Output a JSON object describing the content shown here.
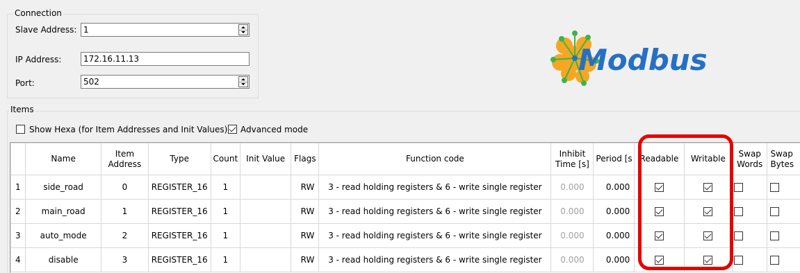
{
  "connection": {
    "group_label": "Connection",
    "slave_address_label": "Slave Address:",
    "slave_address_value": "1",
    "ip_address_label": "IP Address:",
    "ip_address_value": "172.16.11.13",
    "port_label": "Port:",
    "port_value": "502"
  },
  "logo": {
    "text": "Modbus"
  },
  "items": {
    "group_label": "Items",
    "show_hexa_label": "Show Hexa (for Item Addresses and Init Values)",
    "show_hexa_checked": false,
    "advanced_mode_label": "Advanced mode",
    "advanced_mode_checked": true
  },
  "table": {
    "headers": {
      "name": "Name",
      "item_address_l1": "Item",
      "item_address_l2": "Address",
      "type": "Type",
      "count": "Count",
      "init_value": "Init Value",
      "flags": "Flags",
      "function_code": "Function code",
      "inhibit_l1": "Inhibit",
      "inhibit_l2": "Time [s]",
      "period": "Period [s",
      "readable": "Readable",
      "writable": "Writable",
      "swap_words_l1": "Swap",
      "swap_words_l2": "Words",
      "swap_bytes_l1": "Swap",
      "swap_bytes_l2": "Bytes"
    },
    "rows": [
      {
        "num": "1",
        "name": "side_road",
        "address": "0",
        "type": "REGISTER_16",
        "count": "1",
        "init": "",
        "flags": "RW",
        "function": "3 - read holding registers & 6 - write single register",
        "inhibit": "0.000",
        "period": "0.000",
        "readable": true,
        "writable": true,
        "swap_words": false,
        "swap_bytes": false
      },
      {
        "num": "2",
        "name": "main_road",
        "address": "1",
        "type": "REGISTER_16",
        "count": "1",
        "init": "",
        "flags": "RW",
        "function": "3 - read holding registers & 6 - write single register",
        "inhibit": "0.000",
        "period": "0.000",
        "readable": true,
        "writable": true,
        "swap_words": false,
        "swap_bytes": false
      },
      {
        "num": "3",
        "name": "auto_mode",
        "address": "2",
        "type": "REGISTER_16",
        "count": "1",
        "init": "",
        "flags": "RW",
        "function": "3 - read holding registers & 6 - write single register",
        "inhibit": "0.000",
        "period": "0.000",
        "readable": true,
        "writable": true,
        "swap_words": false,
        "swap_bytes": false
      },
      {
        "num": "4",
        "name": "disable",
        "address": "3",
        "type": "REGISTER_16",
        "count": "1",
        "init": "",
        "flags": "RW",
        "function": "3 - read holding registers & 6 - write single register",
        "inhibit": "0.000",
        "period": "0.000",
        "readable": true,
        "writable": true,
        "swap_words": false,
        "swap_bytes": false
      }
    ]
  },
  "colors": {
    "highlight": "#e60000",
    "logo_blue": "#2570c4",
    "logo_orange": "#f5a623",
    "logo_green": "#3ab54a"
  }
}
